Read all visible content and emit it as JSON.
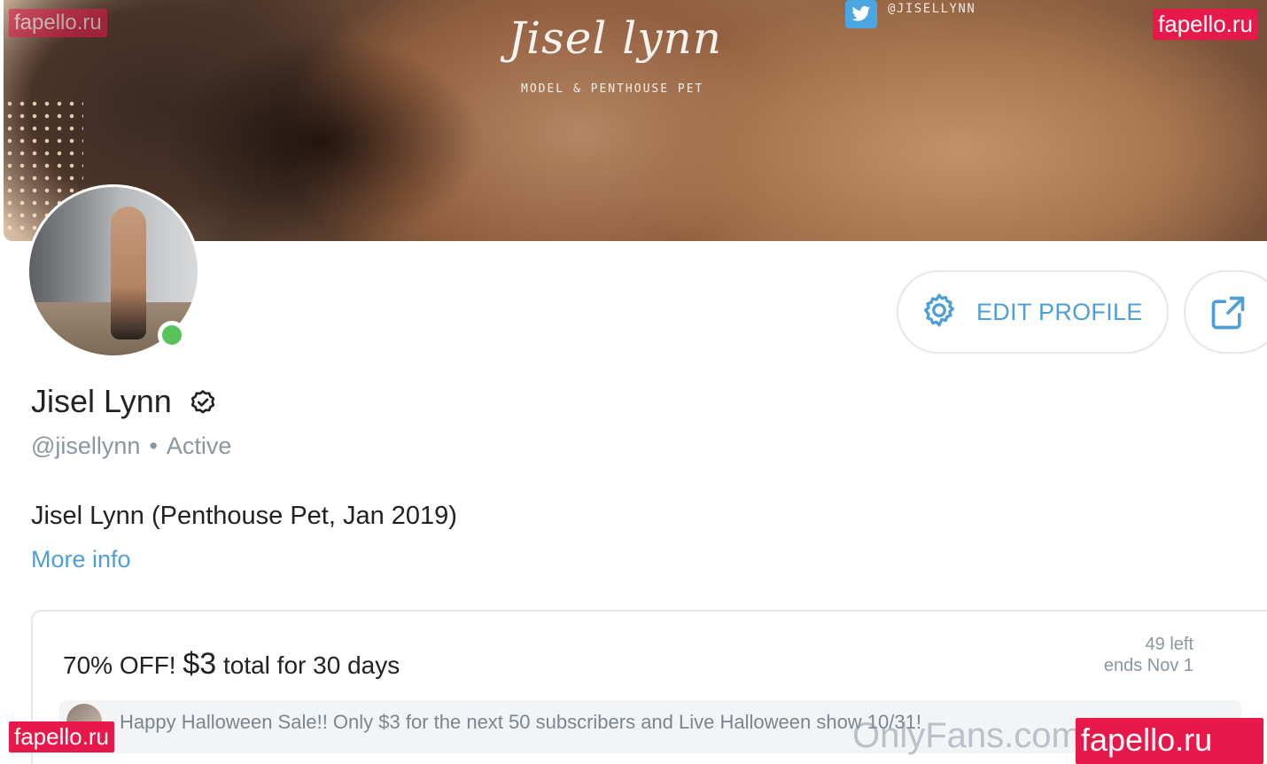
{
  "cover": {
    "title": "Jisel lynn",
    "subtitle": "MODEL & PENTHOUSE PET",
    "twitter_handle": "@JISELLYNN"
  },
  "watermarks": {
    "top_left": "fapello.ru",
    "top_right": "fapello.ru",
    "bottom_left": "fapello.ru",
    "bottom_right": "fapello.ru",
    "site": "OnlyFans.com"
  },
  "profile": {
    "name": "Jisel Lynn",
    "handle": "@jisellynn",
    "separator": "•",
    "status": "Active",
    "bio": "Jisel Lynn (Penthouse Pet, Jan 2019)",
    "more_info": "More info",
    "online": true
  },
  "actions": {
    "edit_profile": "EDIT PROFILE"
  },
  "promo": {
    "title_prefix": "70% OFF! ",
    "price": "$3",
    "title_suffix": " total for 30 days",
    "left": "49 left",
    "ends": "ends Nov 1",
    "message": "Happy Halloween Sale!! Only $3 for the next 50 subscribers and Live Halloween show 10/31!"
  },
  "colors": {
    "accent": "#4e9fd5",
    "online": "#58c35a",
    "watermark": "#e8184a",
    "muted": "#8a96a0"
  }
}
